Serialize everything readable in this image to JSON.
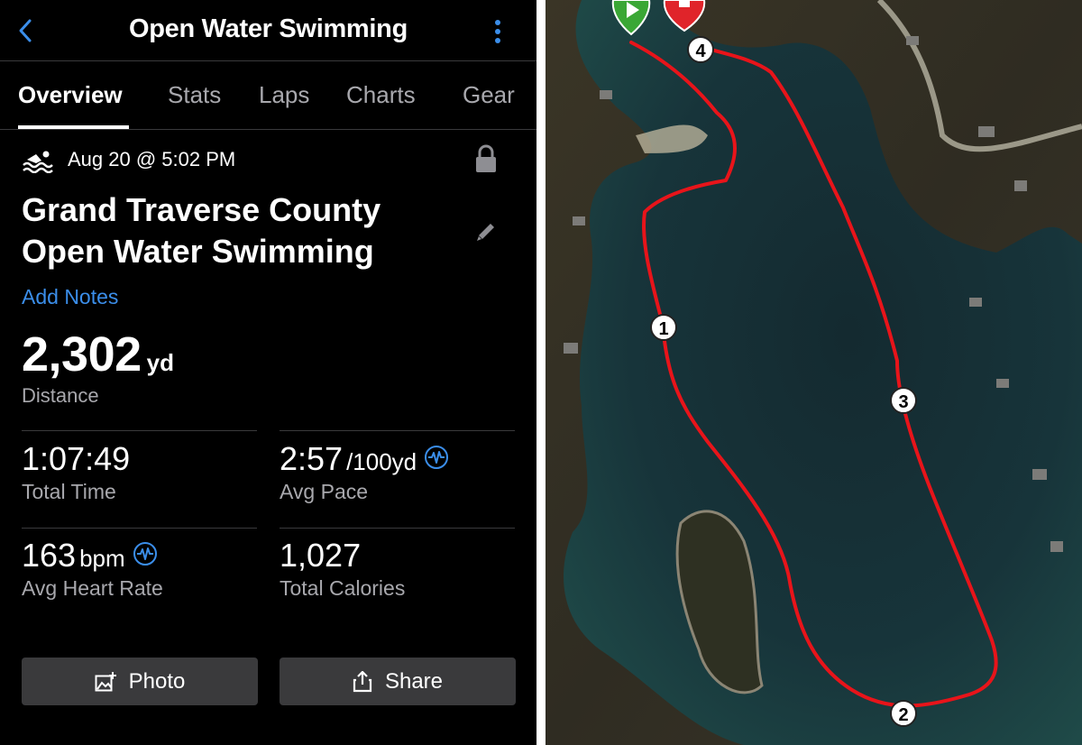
{
  "header": {
    "title": "Open Water Swimming",
    "back_icon": "chevron-left-icon",
    "menu_icon": "more-vertical-icon"
  },
  "tabs": [
    {
      "label": "Overview",
      "active": true
    },
    {
      "label": "Stats"
    },
    {
      "label": "Laps"
    },
    {
      "label": "Charts"
    },
    {
      "label": "Gear"
    }
  ],
  "activity": {
    "date": "Aug 20 @ 5:02 PM",
    "title_line1": "Grand Traverse County",
    "title_line2": "Open Water Swimming",
    "add_notes": "Add Notes"
  },
  "distance": {
    "value": "2,302",
    "unit": "yd",
    "label": "Distance"
  },
  "stats": {
    "total_time": {
      "value": "1:07:49",
      "label": "Total Time"
    },
    "avg_pace": {
      "value": "2:57",
      "unit": "/100yd",
      "label": "Avg Pace"
    },
    "avg_hr": {
      "value": "163",
      "unit": "bpm",
      "label": "Avg Heart Rate"
    },
    "calories": {
      "value": "1,027",
      "label": "Total Calories"
    }
  },
  "buttons": {
    "photo": "Photo",
    "share": "Share"
  },
  "map": {
    "lap_markers": [
      "1",
      "2",
      "3",
      "4"
    ],
    "route_color": "#e8141a",
    "start_color": "#3aa735",
    "end_color": "#e0242a"
  },
  "colors": {
    "accent": "#3b8eea",
    "background": "#000000",
    "secondary_text": "#a8a8ad"
  }
}
